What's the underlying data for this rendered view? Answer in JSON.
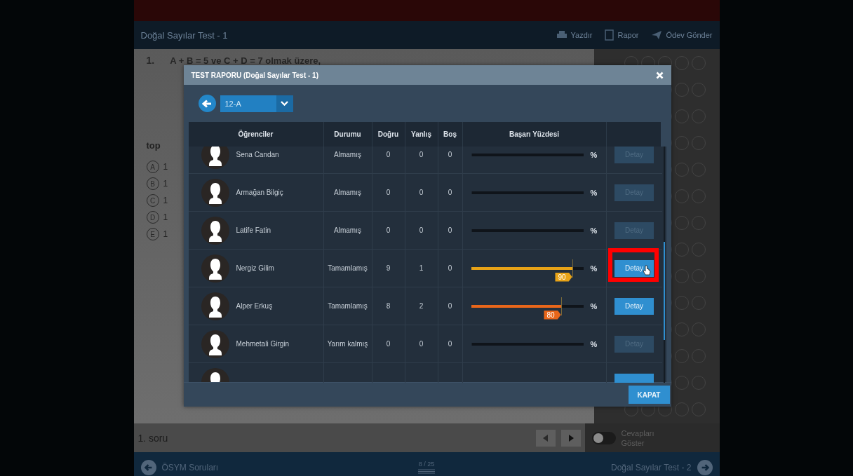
{
  "header": {
    "title": "Doğal Sayılar Test - 1",
    "actions": [
      {
        "kind": "print",
        "label": "Yazdır"
      },
      {
        "kind": "report",
        "label": "Rapor"
      },
      {
        "kind": "send",
        "label": "Ödev Gönder"
      }
    ]
  },
  "question": {
    "number": "1.",
    "text": "A + B = 5 ve C + D = 7 olmak üzere,",
    "prompt": "top",
    "options": [
      {
        "letter": "A",
        "text": "1"
      },
      {
        "letter": "B",
        "text": "1"
      },
      {
        "letter": "C",
        "text": "1"
      },
      {
        "letter": "D",
        "text": "1"
      },
      {
        "letter": "E",
        "text": "1"
      }
    ]
  },
  "dialog": {
    "title": "TEST RAPORU (Doğal Sayılar Test - 1)",
    "class_select": {
      "value": "12-A"
    },
    "columns": [
      "Öğrenciler",
      "Durumu",
      "Doğru",
      "Yanlış",
      "Boş",
      "Başarı Yüzdesi"
    ],
    "rows": [
      {
        "name": "Sena Candan",
        "status": "Almamış",
        "correct": "0",
        "wrong": "0",
        "empty": "0",
        "level": 0,
        "percent": "%",
        "button": "Detay",
        "disabled": true,
        "highlighted": false
      },
      {
        "name": "Armağan Bilgiç",
        "status": "Almamış",
        "correct": "0",
        "wrong": "0",
        "empty": "0",
        "level": 0,
        "percent": "%",
        "button": "Detay",
        "disabled": true,
        "highlighted": false
      },
      {
        "name": "Latife Fatin",
        "status": "Almamış",
        "correct": "0",
        "wrong": "0",
        "empty": "0",
        "level": 0,
        "percent": "%",
        "button": "Detay",
        "disabled": true,
        "highlighted": false
      },
      {
        "name": "Nergiz Gilim",
        "status": "Tamamlamış",
        "correct": "9",
        "wrong": "1",
        "empty": "0",
        "level": 0.9,
        "score": "90",
        "color": "#e8a317",
        "percent": "%",
        "button": "Detay",
        "disabled": false,
        "highlighted": true
      },
      {
        "name": "Alper Erkuş",
        "status": "Tamamlamış",
        "correct": "8",
        "wrong": "2",
        "empty": "0",
        "level": 0.8,
        "score": "80",
        "color": "#e8661a",
        "percent": "%",
        "button": "Detay",
        "disabled": false,
        "highlighted": false
      },
      {
        "name": "Mehmetali Girgin",
        "status": "Yarım kalmış",
        "correct": "0",
        "wrong": "0",
        "empty": "0",
        "level": 0,
        "percent": "%",
        "button": "Detay",
        "disabled": true,
        "highlighted": false
      }
    ],
    "close_button": "KAPAT"
  },
  "bottom_bar": {
    "question_label": "1. soru",
    "toggle": {
      "label": "Cevapları Göster",
      "on": false
    }
  },
  "footer": {
    "previous": "ÖSYM Soruları",
    "page": "8 / 25",
    "next": "Doğal Sayılar Test - 2"
  }
}
